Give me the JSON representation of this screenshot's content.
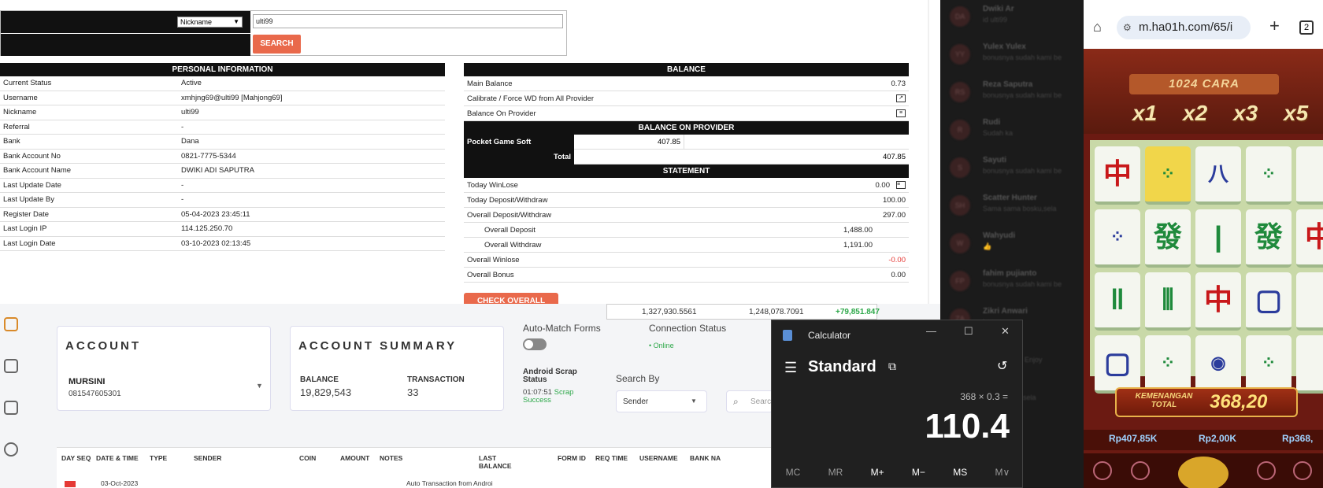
{
  "search": {
    "field_option": "Nickname",
    "query": "ulti99",
    "button_label": "SEARCH"
  },
  "personal": {
    "heading": "PERSONAL INFORMATION",
    "rows": [
      {
        "label": "Current Status",
        "value": "Active"
      },
      {
        "label": "Username",
        "value": "xmhjng69@ulti99  [Mahjong69]"
      },
      {
        "label": "Nickname",
        "value": "ulti99"
      },
      {
        "label": "Referral",
        "value": "-"
      },
      {
        "label": "Bank",
        "value": "Dana"
      },
      {
        "label": "Bank Account No",
        "value": "0821-7775-5344"
      },
      {
        "label": "Bank Account Name",
        "value": "DWIKI ADI SAPUTRA"
      },
      {
        "label": "Last Update Date",
        "value": "-"
      },
      {
        "label": "Last Update By",
        "value": "-"
      },
      {
        "label": "Register Date",
        "value": "05-04-2023 23:45:11"
      },
      {
        "label": "Last Login IP",
        "value": "114.125.250.70"
      },
      {
        "label": "Last Login Date",
        "value": "03-10-2023 02:13:45"
      }
    ]
  },
  "balance": {
    "heading": "BALANCE",
    "main_label": "Main Balance",
    "main_value": "0.73",
    "calibrate_label": "Calibrate / Force WD from All Provider",
    "on_provider_label": "Balance On Provider",
    "provider_heading": "BALANCE ON PROVIDER",
    "provider_name": "Pocket Game Soft",
    "provider_amount": "407.85",
    "total_label": "Total",
    "total_value": "407.85"
  },
  "statement": {
    "heading": "STATEMENT",
    "today_winlose_label": "Today WinLose",
    "today_winlose": "0.00",
    "today_dw_label": "Today Deposit/Withdraw",
    "today_dw": "100.00",
    "overall_dw_label": "Overall Deposit/Withdraw",
    "overall_dw": "297.00",
    "overall_deposit_label": "Overall Deposit",
    "overall_deposit": "1,488.00",
    "overall_withdraw_label": "Overall Withdraw",
    "overall_withdraw": "1,191.00",
    "overall_winlose_label": "Overall Winlose",
    "overall_winlose": "-0.00",
    "overall_bonus_label": "Overall Bonus",
    "overall_bonus": "0.00",
    "check_button": "CHECK OVERALL"
  },
  "dashboard": {
    "ticker": {
      "a": "1,327,930.5561",
      "b": "1,248,078.7091",
      "c": "+79,851.847"
    },
    "account_title": "ACCOUNT",
    "account_name": "MURSINI",
    "account_number": "081547605301",
    "summary_title": "ACCOUNT SUMMARY",
    "balance_label": "BALANCE",
    "balance_value": "19,829,543",
    "transaction_label": "TRANSACTION",
    "transaction_value": "33",
    "auto_match_label": "Auto-Match Forms",
    "connection_label": "Connection Status",
    "connection_value": "• Online",
    "scrap_label": "Android Scrap Status",
    "scrap_time": "01:07:51",
    "scrap_status": "Scrap Success",
    "search_by_label": "Search By",
    "search_by_value": "Sender",
    "search_placeholder": "Search",
    "columns": [
      "DAY SEQ",
      "DATE & TIME",
      "TYPE",
      "SENDER",
      "COIN",
      "AMOUNT",
      "NOTES",
      "LAST BALANCE",
      "FORM ID",
      "REQ TIME",
      "USERNAME",
      "BANK NA"
    ],
    "first_row_date": "03-Oct-2023",
    "first_row_notes": "Auto Transaction from Androi"
  },
  "chat": [
    {
      "avatar": "DA",
      "name": "Dwiki Ar",
      "msg": "id ulti99"
    },
    {
      "avatar": "YY",
      "name": "Yulex Yulex",
      "msg": "bonusnya sudah kami be"
    },
    {
      "avatar": "RS",
      "name": "Reza Saputra",
      "msg": "bonusnya sudah kami be"
    },
    {
      "avatar": "R",
      "name": "Rudi",
      "msg": "Sudah ka"
    },
    {
      "avatar": "S",
      "name": "Sayuti",
      "msg": "bonusnya sudah kami be"
    },
    {
      "avatar": "SH",
      "name": "Scatter Hunter",
      "msg": "Sama sama bosku,sela"
    },
    {
      "avatar": "W",
      "name": "Wahyudi",
      "msg": "👍"
    },
    {
      "avatar": "FP",
      "name": "fahim pujianto",
      "msg": "bonusnya sudah kami be"
    },
    {
      "avatar": "ZA",
      "name": "Zikri Anwari",
      "msg": "bonus"
    },
    {
      "avatar": "",
      "name": "",
      "msg": "bosku bosku Enjoy"
    },
    {
      "avatar": "",
      "name": "",
      "msg": "sama bosku,sela"
    },
    {
      "avatar": "",
      "name": "an",
      "msg": "bosku,sela"
    }
  ],
  "calculator": {
    "title": "Calculator",
    "mode": "Standard",
    "expression": "368 × 0.3 =",
    "result": "110.4",
    "memory_keys": [
      "MC",
      "MR",
      "M+",
      "M−",
      "MS",
      "M∨"
    ]
  },
  "phone": {
    "url": "m.ha01h.com/65/i",
    "tab_count": "2",
    "banner": "1024 CARA",
    "multipliers": [
      "x1",
      "x2",
      "x3",
      "x5"
    ],
    "win_label": "KEMENANGAN TOTAL",
    "win_value": "368,20",
    "balance": "Rp407,85K",
    "bet": "Rp2,00K",
    "win_stat": "Rp368,"
  }
}
